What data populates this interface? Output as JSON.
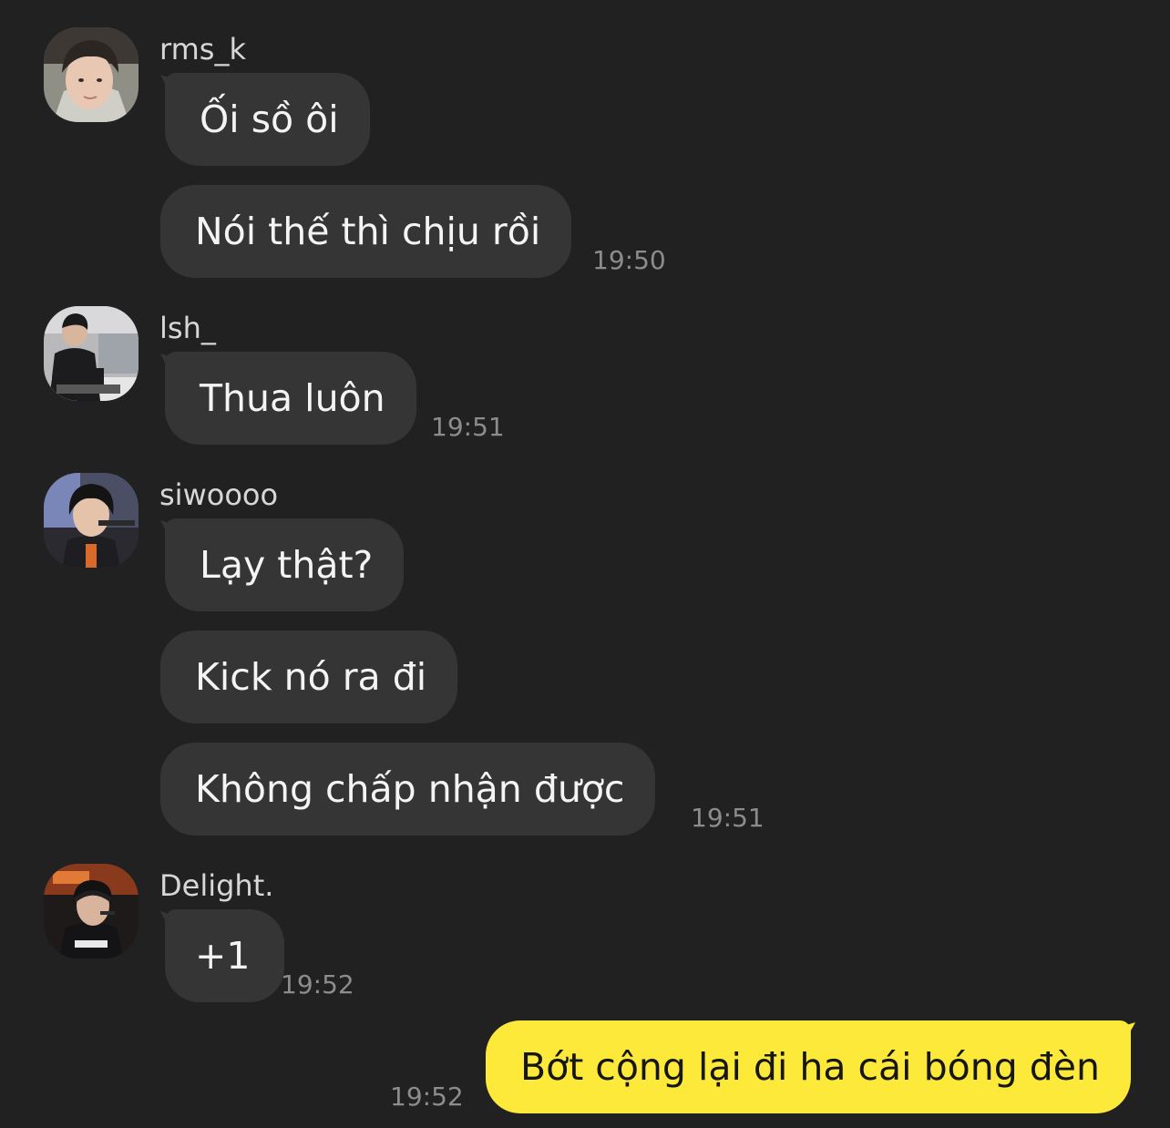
{
  "colors": {
    "background": "#212121",
    "incoming_bubble": "#353535",
    "outgoing_bubble": "#fde93a",
    "sender_name": "#d7d7d7",
    "timestamp": "#8c8c8c"
  },
  "messages": [
    {
      "sender": "rms_k",
      "avatar": "rms-k-avatar",
      "bubbles": [
        "Ối sồ ôi",
        "Nói thế thì chịu rồi"
      ],
      "time": "19:50"
    },
    {
      "sender": "lsh_",
      "avatar": "lsh-avatar",
      "bubbles": [
        "Thua luôn"
      ],
      "time": "19:51"
    },
    {
      "sender": "siwoooo",
      "avatar": "siwoooo-avatar",
      "bubbles": [
        "Lạy thật?",
        "Kick nó ra đi",
        "Không chấp nhận được"
      ],
      "time": "19:51"
    },
    {
      "sender": "Delight.",
      "avatar": "delight-avatar",
      "bubbles": [
        "+1"
      ],
      "time": "19:52"
    }
  ],
  "outgoing": {
    "text": "Bớt cộng lại đi ha cái bóng đèn",
    "time": "19:52"
  }
}
